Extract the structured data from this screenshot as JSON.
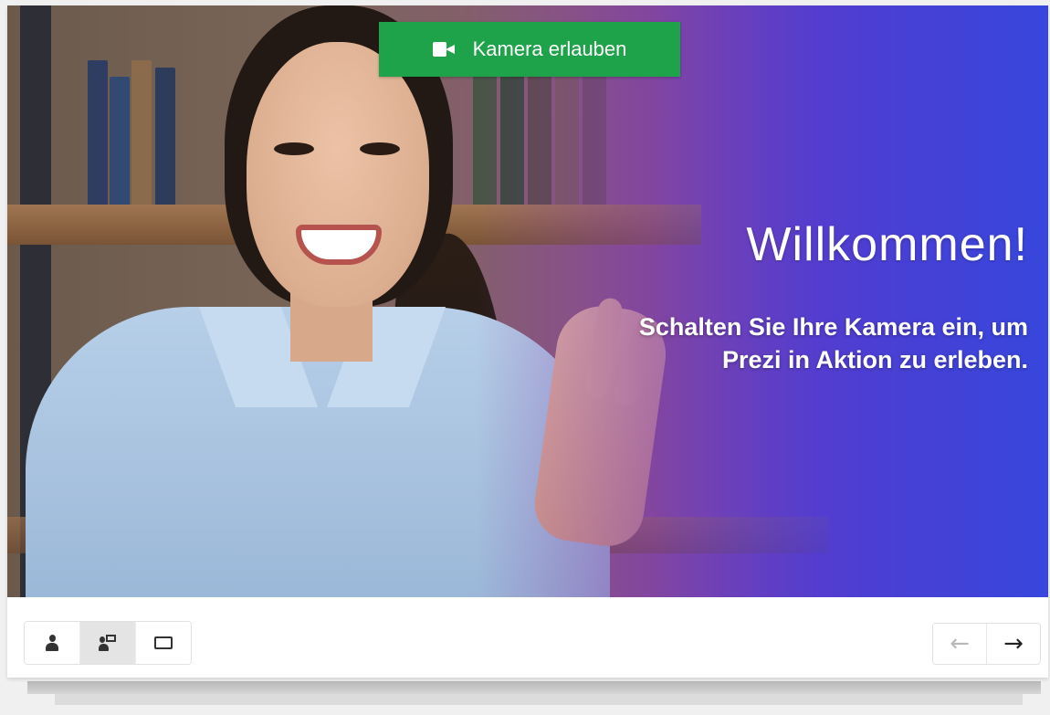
{
  "camera_prompt": {
    "button_label": "Kamera erlauben",
    "icon": "video-camera-icon",
    "color": "#1ea34a"
  },
  "welcome": {
    "title": "Willkommen!",
    "subtitle_line1": "Schalten Sie Ihre Kamera ein, um",
    "subtitle_line2": "Prezi in Aktion zu erleben."
  },
  "toolbar": {
    "view_modes": [
      {
        "name": "presenter-only",
        "icon": "person-icon",
        "active": false
      },
      {
        "name": "presenter-with-content",
        "icon": "presenter-board-icon",
        "active": true
      },
      {
        "name": "content-only",
        "icon": "screen-icon",
        "active": false
      }
    ],
    "nav": {
      "prev_symbol": "←",
      "next_symbol": "→"
    }
  },
  "colors": {
    "gradient_end": "#3a46d8",
    "gradient_mid": "#7c4aa8"
  }
}
